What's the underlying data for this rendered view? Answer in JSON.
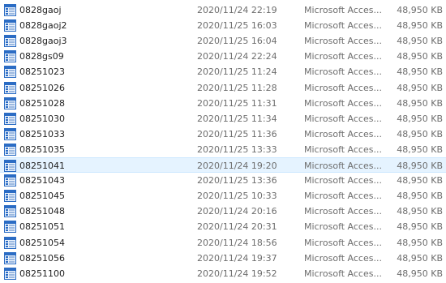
{
  "files": [
    {
      "name": "0828gaoj",
      "date": "2020/11/24 22:19",
      "type": "Microsoft Acces...",
      "size": "48,950 KB",
      "icon": "access-database-icon"
    },
    {
      "name": "0828gaoj2",
      "date": "2020/11/25 16:03",
      "type": "Microsoft Acces...",
      "size": "48,950 KB",
      "icon": "access-database-icon"
    },
    {
      "name": "0828gaoj3",
      "date": "2020/11/25 16:04",
      "type": "Microsoft Acces...",
      "size": "48,950 KB",
      "icon": "access-database-icon"
    },
    {
      "name": "0828gs09",
      "date": "2020/11/24 22:24",
      "type": "Microsoft Acces...",
      "size": "48,950 KB",
      "icon": "access-database-icon"
    },
    {
      "name": "08251023",
      "date": "2020/11/25 11:24",
      "type": "Microsoft Acces...",
      "size": "48,950 KB",
      "icon": "access-database-icon"
    },
    {
      "name": "08251026",
      "date": "2020/11/25 11:28",
      "type": "Microsoft Acces...",
      "size": "48,950 KB",
      "icon": "access-database-icon"
    },
    {
      "name": "08251028",
      "date": "2020/11/25 11:31",
      "type": "Microsoft Acces...",
      "size": "48,950 KB",
      "icon": "access-database-icon"
    },
    {
      "name": "08251030",
      "date": "2020/11/25 11:34",
      "type": "Microsoft Acces...",
      "size": "48,950 KB",
      "icon": "access-database-icon"
    },
    {
      "name": "08251033",
      "date": "2020/11/25 11:36",
      "type": "Microsoft Acces...",
      "size": "48,950 KB",
      "icon": "access-database-icon"
    },
    {
      "name": "08251035",
      "date": "2020/11/25 13:33",
      "type": "Microsoft Acces...",
      "size": "48,950 KB",
      "icon": "access-database-icon"
    },
    {
      "name": "08251041",
      "date": "2020/11/24 19:20",
      "type": "Microsoft Acces...",
      "size": "48,950 KB",
      "icon": "access-database-icon",
      "selected": true
    },
    {
      "name": "08251043",
      "date": "2020/11/25 13:36",
      "type": "Microsoft Acces...",
      "size": "48,950 KB",
      "icon": "access-database-icon"
    },
    {
      "name": "08251045",
      "date": "2020/11/25 10:33",
      "type": "Microsoft Acces...",
      "size": "48,950 KB",
      "icon": "access-database-icon"
    },
    {
      "name": "08251048",
      "date": "2020/11/24 20:16",
      "type": "Microsoft Acces...",
      "size": "48,950 KB",
      "icon": "access-database-icon"
    },
    {
      "name": "08251051",
      "date": "2020/11/24 20:31",
      "type": "Microsoft Acces...",
      "size": "48,950 KB",
      "icon": "access-database-icon"
    },
    {
      "name": "08251054",
      "date": "2020/11/24 18:56",
      "type": "Microsoft Acces...",
      "size": "48,950 KB",
      "icon": "access-database-icon"
    },
    {
      "name": "08251056",
      "date": "2020/11/24 19:37",
      "type": "Microsoft Acces...",
      "size": "48,950 KB",
      "icon": "access-database-icon"
    },
    {
      "name": "08251100",
      "date": "2020/11/24 19:52",
      "type": "Microsoft Acces...",
      "size": "48,950 KB",
      "icon": "access-database-icon"
    }
  ],
  "colors": {
    "selection_background": "#e5f3ff",
    "selection_border": "#cce8ff",
    "icon_blue": "#2b6cc4",
    "name_text": "#1f1f1f",
    "detail_text": "#6d6d6d"
  }
}
